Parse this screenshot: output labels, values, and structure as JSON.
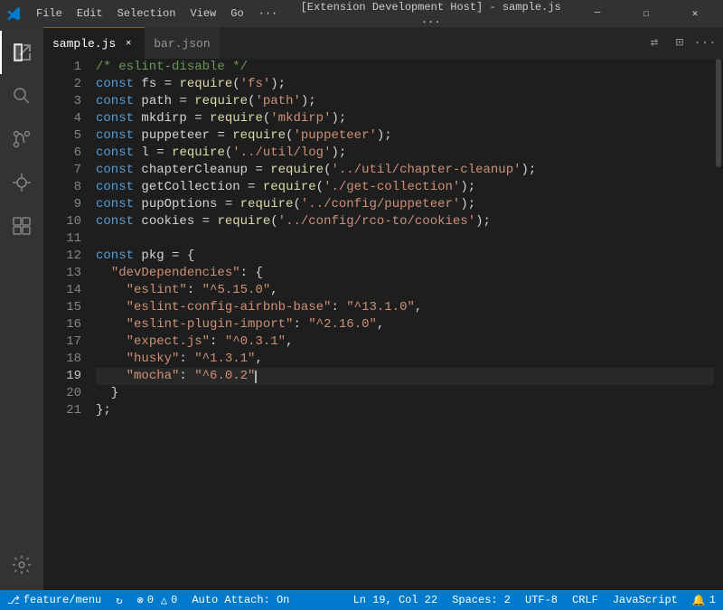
{
  "titlebar": {
    "icon": "⬡",
    "menus": [
      "File",
      "Edit",
      "Selection",
      "View",
      "Go",
      "···"
    ],
    "title": "[Extension Development Host] - sample.js ...",
    "controls": [
      "⧉",
      "☐",
      "✕"
    ]
  },
  "tabs": {
    "active": {
      "label": "sample.js",
      "has_close": true
    },
    "inactive": [
      {
        "label": "bar.json",
        "has_close": false
      }
    ],
    "actions": [
      "⇄",
      "⊡",
      "···"
    ]
  },
  "activity_bar": {
    "items": [
      "explorer",
      "search",
      "source-control",
      "debug",
      "extensions"
    ],
    "icons": [
      "⎗",
      "🔍",
      "⑃",
      "⬡",
      "⊞"
    ],
    "bottom": [
      "⚙"
    ]
  },
  "code": {
    "lines": [
      {
        "num": 1,
        "tokens": [
          {
            "type": "comment",
            "text": "/* eslint-disable */"
          }
        ]
      },
      {
        "num": 2,
        "tokens": [
          {
            "type": "keyword",
            "text": "const"
          },
          {
            "type": "plain",
            "text": " fs "
          },
          {
            "type": "operator",
            "text": "="
          },
          {
            "type": "plain",
            "text": " "
          },
          {
            "type": "function",
            "text": "require"
          },
          {
            "type": "plain",
            "text": "("
          },
          {
            "type": "string",
            "text": "'fs'"
          },
          {
            "type": "plain",
            "text": ");"
          }
        ]
      },
      {
        "num": 3,
        "tokens": [
          {
            "type": "keyword",
            "text": "const"
          },
          {
            "type": "plain",
            "text": " path "
          },
          {
            "type": "operator",
            "text": "="
          },
          {
            "type": "plain",
            "text": " "
          },
          {
            "type": "function",
            "text": "require"
          },
          {
            "type": "plain",
            "text": "("
          },
          {
            "type": "string",
            "text": "'path'"
          },
          {
            "type": "plain",
            "text": ");"
          }
        ]
      },
      {
        "num": 4,
        "tokens": [
          {
            "type": "keyword",
            "text": "const"
          },
          {
            "type": "plain",
            "text": " mkdirp "
          },
          {
            "type": "operator",
            "text": "="
          },
          {
            "type": "plain",
            "text": " "
          },
          {
            "type": "function",
            "text": "require"
          },
          {
            "type": "plain",
            "text": "("
          },
          {
            "type": "string",
            "text": "'mkdirp'"
          },
          {
            "type": "plain",
            "text": ");"
          }
        ]
      },
      {
        "num": 5,
        "tokens": [
          {
            "type": "keyword",
            "text": "const"
          },
          {
            "type": "plain",
            "text": " puppeteer "
          },
          {
            "type": "operator",
            "text": "="
          },
          {
            "type": "plain",
            "text": " "
          },
          {
            "type": "function",
            "text": "require"
          },
          {
            "type": "plain",
            "text": "("
          },
          {
            "type": "string",
            "text": "'puppeteer'"
          },
          {
            "type": "plain",
            "text": ");"
          }
        ]
      },
      {
        "num": 6,
        "tokens": [
          {
            "type": "keyword",
            "text": "const"
          },
          {
            "type": "plain",
            "text": " l "
          },
          {
            "type": "operator",
            "text": "="
          },
          {
            "type": "plain",
            "text": " "
          },
          {
            "type": "function",
            "text": "require"
          },
          {
            "type": "plain",
            "text": "("
          },
          {
            "type": "string",
            "text": "'../util/log'"
          },
          {
            "type": "plain",
            "text": ");"
          }
        ]
      },
      {
        "num": 7,
        "tokens": [
          {
            "type": "keyword",
            "text": "const"
          },
          {
            "type": "plain",
            "text": " chapterCleanup "
          },
          {
            "type": "operator",
            "text": "="
          },
          {
            "type": "plain",
            "text": " "
          },
          {
            "type": "function",
            "text": "require"
          },
          {
            "type": "plain",
            "text": "("
          },
          {
            "type": "string",
            "text": "'../util/chapter-cleanup'"
          },
          {
            "type": "plain",
            "text": ");"
          }
        ]
      },
      {
        "num": 8,
        "tokens": [
          {
            "type": "keyword",
            "text": "const"
          },
          {
            "type": "plain",
            "text": " getCollection "
          },
          {
            "type": "operator",
            "text": "="
          },
          {
            "type": "plain",
            "text": " "
          },
          {
            "type": "function",
            "text": "require"
          },
          {
            "type": "plain",
            "text": "("
          },
          {
            "type": "string",
            "text": "'./get-collection'"
          },
          {
            "type": "plain",
            "text": ");"
          }
        ]
      },
      {
        "num": 9,
        "tokens": [
          {
            "type": "keyword",
            "text": "const"
          },
          {
            "type": "plain",
            "text": " pupOptions "
          },
          {
            "type": "operator",
            "text": "="
          },
          {
            "type": "plain",
            "text": " "
          },
          {
            "type": "function",
            "text": "require"
          },
          {
            "type": "plain",
            "text": "("
          },
          {
            "type": "string",
            "text": "'../config/puppeteer'"
          },
          {
            "type": "plain",
            "text": ");"
          }
        ]
      },
      {
        "num": 10,
        "tokens": [
          {
            "type": "keyword",
            "text": "const"
          },
          {
            "type": "plain",
            "text": " cookies "
          },
          {
            "type": "operator",
            "text": "="
          },
          {
            "type": "plain",
            "text": " "
          },
          {
            "type": "function",
            "text": "require"
          },
          {
            "type": "plain",
            "text": "("
          },
          {
            "type": "string",
            "text": "'../config/rco-to/cookies'"
          },
          {
            "type": "plain",
            "text": ");"
          }
        ]
      },
      {
        "num": 11,
        "tokens": []
      },
      {
        "num": 12,
        "tokens": [
          {
            "type": "keyword",
            "text": "const"
          },
          {
            "type": "plain",
            "text": " pkg "
          },
          {
            "type": "operator",
            "text": "="
          },
          {
            "type": "plain",
            "text": " {"
          }
        ]
      },
      {
        "num": 13,
        "tokens": [
          {
            "type": "plain",
            "text": "  "
          },
          {
            "type": "string",
            "text": "\"devDependencies\""
          },
          {
            "type": "plain",
            "text": ": {"
          }
        ]
      },
      {
        "num": 14,
        "tokens": [
          {
            "type": "plain",
            "text": "    "
          },
          {
            "type": "string",
            "text": "\"eslint\""
          },
          {
            "type": "plain",
            "text": ": "
          },
          {
            "type": "string",
            "text": "\"^5.15.0\""
          },
          {
            "type": "plain",
            "text": ","
          }
        ]
      },
      {
        "num": 15,
        "tokens": [
          {
            "type": "plain",
            "text": "    "
          },
          {
            "type": "string",
            "text": "\"eslint-config-airbnb-base\""
          },
          {
            "type": "plain",
            "text": ": "
          },
          {
            "type": "string",
            "text": "\"^13.1.0\""
          },
          {
            "type": "plain",
            "text": ","
          }
        ]
      },
      {
        "num": 16,
        "tokens": [
          {
            "type": "plain",
            "text": "    "
          },
          {
            "type": "string",
            "text": "\"eslint-plugin-import\""
          },
          {
            "type": "plain",
            "text": ": "
          },
          {
            "type": "string",
            "text": "\"^2.16.0\""
          },
          {
            "type": "plain",
            "text": ","
          }
        ]
      },
      {
        "num": 17,
        "tokens": [
          {
            "type": "plain",
            "text": "    "
          },
          {
            "type": "string",
            "text": "\"expect.js\""
          },
          {
            "type": "plain",
            "text": ": "
          },
          {
            "type": "string",
            "text": "\"^0.3.1\""
          },
          {
            "type": "plain",
            "text": ","
          }
        ]
      },
      {
        "num": 18,
        "tokens": [
          {
            "type": "plain",
            "text": "    "
          },
          {
            "type": "string",
            "text": "\"husky\""
          },
          {
            "type": "plain",
            "text": ": "
          },
          {
            "type": "string",
            "text": "\"^1.3.1\""
          },
          {
            "type": "plain",
            "text": ","
          }
        ]
      },
      {
        "num": 19,
        "tokens": [
          {
            "type": "plain",
            "text": "    "
          },
          {
            "type": "string",
            "text": "\"mocha\""
          },
          {
            "type": "plain",
            "text": ": "
          },
          {
            "type": "string",
            "text": "\"^6.0.2\""
          },
          {
            "type": "plain",
            "text": "_",
            "cursor": true
          }
        ],
        "active": true
      },
      {
        "num": 20,
        "tokens": [
          {
            "type": "plain",
            "text": "  }"
          }
        ]
      },
      {
        "num": 21,
        "tokens": [
          {
            "type": "plain",
            "text": "};"
          }
        ]
      }
    ]
  },
  "statusbar": {
    "left": [
      {
        "icon": "⎇",
        "label": "feature/menu"
      },
      {
        "icon": "↻",
        "label": ""
      },
      {
        "icon": "⚠",
        "label": "0"
      },
      {
        "icon": "⊗",
        "label": "0"
      },
      {
        "label": "Auto Attach: On"
      }
    ],
    "right": [
      {
        "label": "Ln 19, Col 22"
      },
      {
        "label": "Spaces: 2"
      },
      {
        "label": "UTF-8"
      },
      {
        "label": "CRLF"
      },
      {
        "label": "JavaScript"
      },
      {
        "icon": "🔔",
        "label": "1"
      }
    ]
  }
}
